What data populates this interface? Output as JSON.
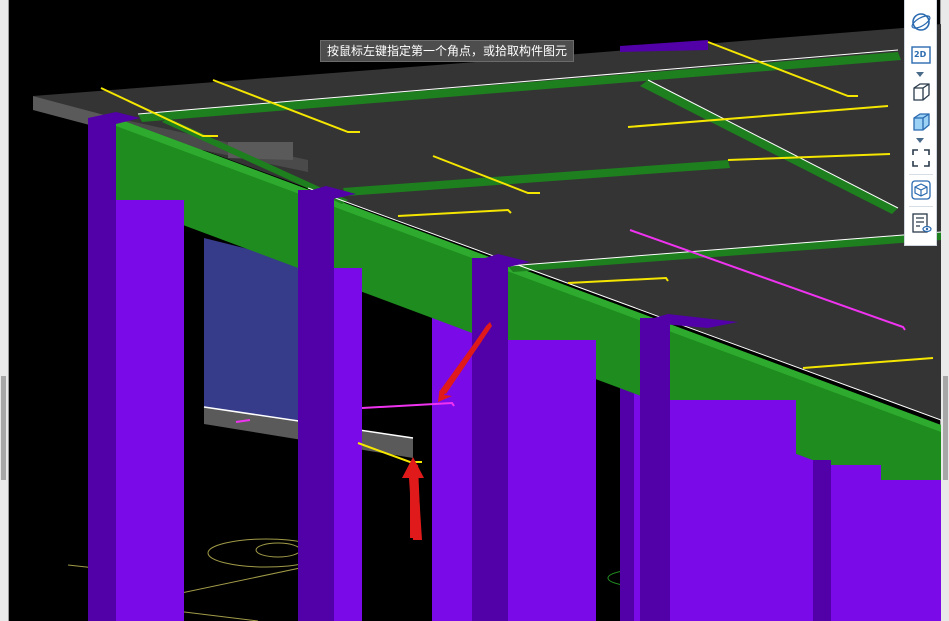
{
  "status_hint": "按鼠标左键指定第一个角点，或拾取构件图元",
  "toolbar": {
    "items": [
      {
        "name": "orbit-icon"
      },
      {
        "name": "view-2d-icon",
        "label": "2D"
      },
      {
        "name": "view-3d-wireframe-icon"
      },
      {
        "name": "view-3d-solid-icon"
      },
      {
        "name": "zoom-extents-icon"
      },
      {
        "name": "display-component-icon"
      },
      {
        "name": "display-settings-icon"
      }
    ]
  },
  "colors": {
    "background": "#000000",
    "slab": "#343434",
    "slab_edge": "#5a5a5a",
    "beam_green": "#1e8c1e",
    "beam_green_dark": "#145f14",
    "column_purple": "#7a0ae8",
    "column_purple_dark": "#5200a8",
    "wall_blue": "#363c8a",
    "rebar_yellow": "#f5e600",
    "rebar_magenta": "#f033f0",
    "arrow_red": "#e01a1a",
    "toolbar_icon": "#2a6ab0"
  }
}
